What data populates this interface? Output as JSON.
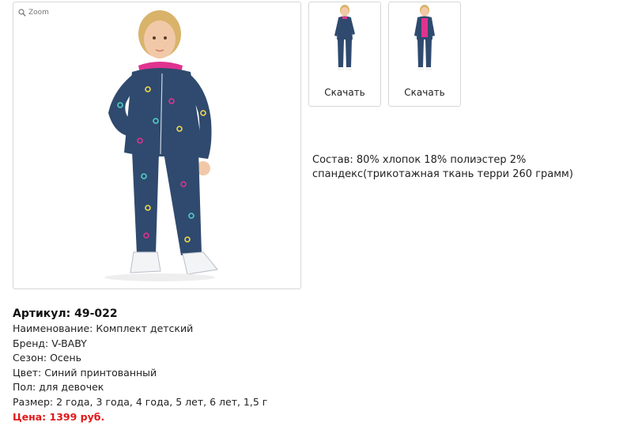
{
  "gallery": {
    "zoom_label": "Zoom",
    "thumbnails": [
      {
        "label": "Скачать"
      },
      {
        "label": "Скачать"
      }
    ]
  },
  "composition": "Состав: 80% хлопок 18% полиэстер 2% спандекс(трикотажная ткань терри 260 грамм)",
  "product": {
    "article": "Артикул: 49-022",
    "name": "Наименование: Комплект детский",
    "brand": "Бренд: V-BABY",
    "season": "Сезон: Осень",
    "color": "Цвет: Синий принтованный",
    "gender": "Пол: для девочек",
    "sizes": "Размер: 2 года, 3 года, 4 года, 5 лет, 6 лет, 1,5 г",
    "price": "Цена: 1399 руб."
  },
  "colors": {
    "price": "#e21818",
    "border": "#d7d7d7",
    "suit": "#2f4a6e",
    "hood_lining": "#e0338f"
  }
}
